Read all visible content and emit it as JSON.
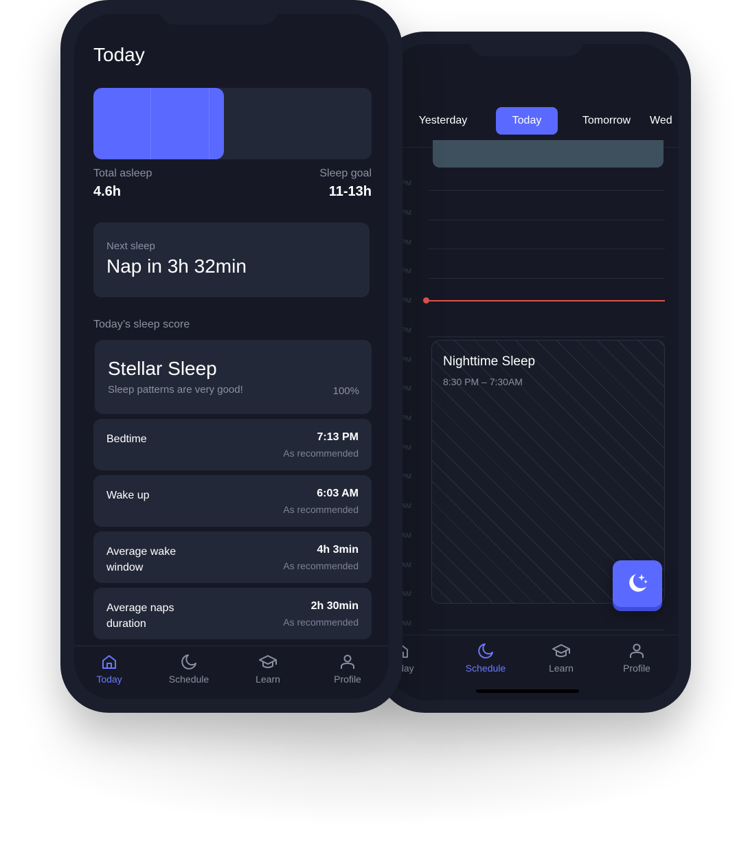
{
  "schedule_screen": {
    "day_tabs": [
      {
        "label": "Yesterday",
        "active": false
      },
      {
        "label": "Today",
        "active": true
      },
      {
        "label": "Tomorrow",
        "active": false
      },
      {
        "label": "Wed",
        "active": false
      }
    ],
    "hour_labels": [
      "PM",
      "PM",
      "PM",
      "PM",
      "PM",
      "PM",
      "PM",
      "PM",
      "PM",
      "PM",
      "PM",
      "AM",
      "AM",
      "AM",
      "AM",
      "AM",
      "AM"
    ],
    "event": {
      "title": "Nighttime Sleep",
      "time": "8:30 PM – 7:30AM"
    },
    "fab_icon": "moon-stars-icon",
    "nav": [
      {
        "label": "Today",
        "icon": "home-icon",
        "active": false
      },
      {
        "label": "Schedule",
        "icon": "moon-icon",
        "active": true
      },
      {
        "label": "Learn",
        "icon": "graduation-cap-icon",
        "active": false
      },
      {
        "label": "Profile",
        "icon": "person-icon",
        "active": false
      }
    ]
  },
  "today_screen": {
    "title": "Today",
    "sleep_progress": {
      "asleep_hours": 4.6,
      "bar_fill_fraction": 0.47,
      "total_asleep_label": "Total asleep",
      "total_asleep_value": "4.6h",
      "sleep_goal_label": "Sleep goal",
      "sleep_goal_value": "11-13h"
    },
    "next_sleep": {
      "label": "Next sleep",
      "value": "Nap in 3h 32min"
    },
    "score_section_label": "Today’s sleep score",
    "score": {
      "title": "Stellar Sleep",
      "subtitle": "Sleep patterns are very good!",
      "percent": "100%"
    },
    "metrics": [
      {
        "label": "Bedtime",
        "value": "7:13 PM",
        "note": "As recommended"
      },
      {
        "label": "Wake up",
        "value": "6:03 AM",
        "note": "As recommended"
      },
      {
        "label": "Average wake window",
        "value": "4h 3min",
        "note": "As recommended"
      },
      {
        "label": "Average naps duration",
        "value": "2h 30min",
        "note": "As recommended"
      }
    ],
    "nav": [
      {
        "label": "Today",
        "icon": "home-icon",
        "active": true
      },
      {
        "label": "Schedule",
        "icon": "moon-icon",
        "active": false
      },
      {
        "label": "Learn",
        "icon": "graduation-cap-icon",
        "active": false
      },
      {
        "label": "Profile",
        "icon": "person-icon",
        "active": false
      }
    ],
    "colors": {
      "accent": "#5a69ff",
      "background": "#161925",
      "card": "#232838",
      "now_line": "#e0524c"
    }
  }
}
